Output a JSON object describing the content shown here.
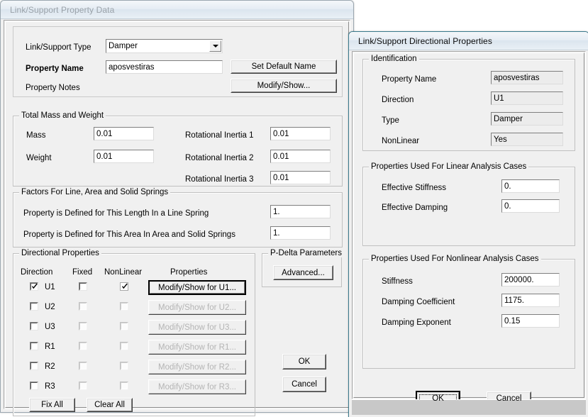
{
  "dialog1": {
    "title": "Link/Support Property Data",
    "active": false,
    "general": {
      "type_label": "Link/Support Type",
      "type_value": "Damper",
      "property_name_label": "Property Name",
      "property_name_value": "aposvestiras",
      "property_notes_label": "Property Notes",
      "set_default_name_button": "Set Default Name",
      "modify_show_button": "Modify/Show..."
    },
    "mass_group": {
      "legend": "Total Mass and Weight",
      "mass_label": "Mass",
      "mass_value": "0.01",
      "weight_label": "Weight",
      "weight_value": "0.01",
      "ri1_label": "Rotational Inertia 1",
      "ri1_value": "0.01",
      "ri2_label": "Rotational Inertia 2",
      "ri2_value": "0.01",
      "ri3_label": "Rotational Inertia 3",
      "ri3_value": "0.01"
    },
    "factors_group": {
      "legend": "Factors For Line, Area and Solid Springs",
      "length_label": "Property is Defined for This Length In a Line Spring",
      "length_value": "1.",
      "area_label": "Property is Defined for This Area In Area and Solid Springs",
      "area_value": "1."
    },
    "directional_group": {
      "legend": "Directional Properties",
      "col_direction": "Direction",
      "col_fixed": "Fixed",
      "col_nonlinear": "NonLinear",
      "col_properties": "Properties",
      "rows": [
        {
          "direction": "U1",
          "checked": true,
          "fixed": false,
          "nonlinear": true,
          "button": "Modify/Show for U1...",
          "enabled": true
        },
        {
          "direction": "U2",
          "checked": false,
          "fixed": false,
          "nonlinear": false,
          "button": "Modify/Show for U2...",
          "enabled": false
        },
        {
          "direction": "U3",
          "checked": false,
          "fixed": false,
          "nonlinear": false,
          "button": "Modify/Show for U3...",
          "enabled": false
        },
        {
          "direction": "R1",
          "checked": false,
          "fixed": false,
          "nonlinear": false,
          "button": "Modify/Show for R1...",
          "enabled": false
        },
        {
          "direction": "R2",
          "checked": false,
          "fixed": false,
          "nonlinear": false,
          "button": "Modify/Show for R2...",
          "enabled": false
        },
        {
          "direction": "R3",
          "checked": false,
          "fixed": false,
          "nonlinear": false,
          "button": "Modify/Show for R3...",
          "enabled": false
        }
      ],
      "fix_all_button": "Fix All",
      "clear_all_button": "Clear All"
    },
    "pdelta_group": {
      "legend": "P-Delta Parameters",
      "advanced_button": "Advanced..."
    },
    "ok_button": "OK",
    "cancel_button": "Cancel"
  },
  "dialog2": {
    "title": "Link/Support Directional Properties",
    "active": true,
    "identification": {
      "legend": "Identification",
      "property_name_label": "Property Name",
      "property_name_value": "aposvestiras",
      "direction_label": "Direction",
      "direction_value": "U1",
      "type_label": "Type",
      "type_value": "Damper",
      "nonlinear_label": "NonLinear",
      "nonlinear_value": "Yes"
    },
    "linear_group": {
      "legend": "Properties Used For Linear Analysis Cases",
      "effective_stiffness_label": "Effective Stiffness",
      "effective_stiffness_value": "0.",
      "effective_damping_label": "Effective Damping",
      "effective_damping_value": "0."
    },
    "nonlinear_group": {
      "legend": "Properties Used For Nonlinear Analysis Cases",
      "stiffness_label": "Stiffness",
      "stiffness_value": "200000.",
      "damping_coefficient_label": "Damping Coefficient",
      "damping_coefficient_value": "1175.",
      "damping_exponent_label": "Damping Exponent",
      "damping_exponent_value": "0.15"
    },
    "ok_button": "OK",
    "cancel_button": "Cancel"
  },
  "colors": {
    "dialog_face": "#f0f0f0",
    "title_active_text": "#0b0b0b",
    "title_inactive_text": "#9aa2a9",
    "field_bg": "#ffffff",
    "readonly_field_bg": "#ececec",
    "statusbar": "#c8c8c8"
  }
}
